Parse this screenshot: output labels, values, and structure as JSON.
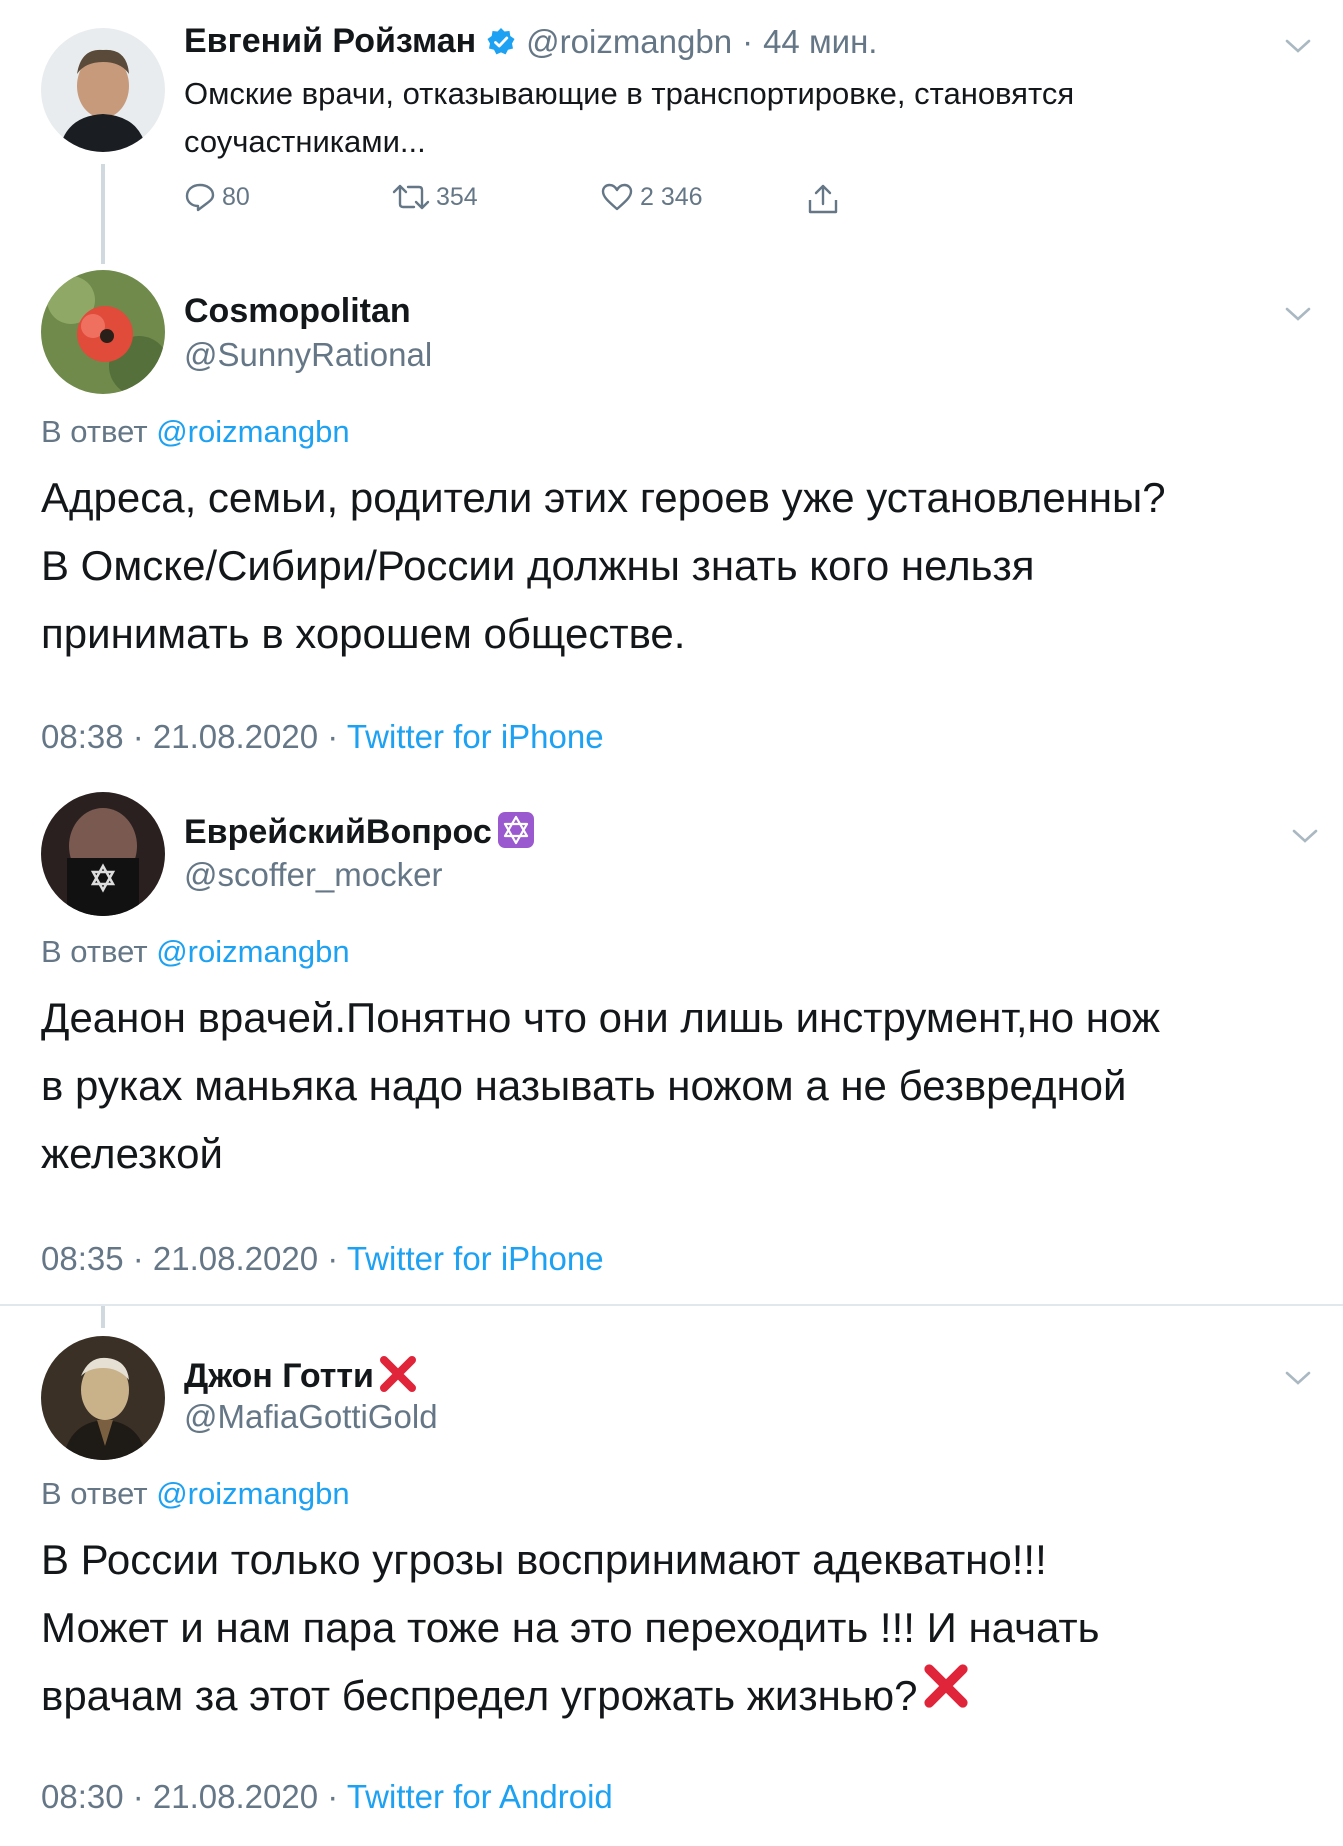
{
  "tweets": [
    {
      "name": "Евгений Ройзман",
      "handle": "@roizmangbn",
      "time_sep": "·",
      "time": "44 мин.",
      "text_line1": "Омские врачи, отказывающие в транспортировке, становятся",
      "text_line2": "соучастниками...",
      "replies": "80",
      "retweets": "354",
      "likes": "2 346"
    },
    {
      "name": "Cosmopolitan",
      "handle": "@SunnyRational",
      "reply_prefix": "В ответ",
      "reply_to": "@roizmangbn",
      "text_lines": [
        "Адреса, семьи, родители этих героев уже установленны?",
        "В Омске/Сибири/России должны знать кого нельзя",
        "принимать в хорошем обществе."
      ],
      "timestamp": "08:38 · 21.08.2020 ·",
      "source": "Twitter for iPhone"
    },
    {
      "name": "ЕврейскийВопрос",
      "handle": "@scoffer_mocker",
      "reply_prefix": "В ответ",
      "reply_to": "@roizmangbn",
      "text_lines": [
        "Деанон врачей.Понятно что они лишь инструмент,но нож",
        "в руках маньяка надо называть ножом а не безвредной",
        "железкой"
      ],
      "timestamp": "08:35 · 21.08.2020 ·",
      "source": "Twitter for iPhone"
    },
    {
      "name": "Джон Готти",
      "handle": "@MafiaGottiGold",
      "reply_prefix": "В ответ",
      "reply_to": "@roizmangbn",
      "text_lines": [
        "В России только угрозы воспринимают адекватно!!!",
        "Может и нам пара тоже на это переходить !!! И начать",
        "врачам за этот беспредел угрожать жизнью?"
      ],
      "timestamp": "08:30 · 21.08.2020 ·",
      "source": "Twitter for Android"
    }
  ],
  "icons": {
    "verified": "verified-badge-icon",
    "reply": "reply-icon",
    "retweet": "retweet-icon",
    "like": "like-icon",
    "share": "share-icon",
    "chevron": "chevron-down-icon",
    "star_of_david": "star-of-david-emoji",
    "cross_mark": "cross-mark-emoji"
  },
  "colors": {
    "link_blue": "#1da1f2",
    "secondary_gray": "#657786",
    "cross_red": "#e0243a",
    "emoji_purple": "#9b59d0"
  }
}
